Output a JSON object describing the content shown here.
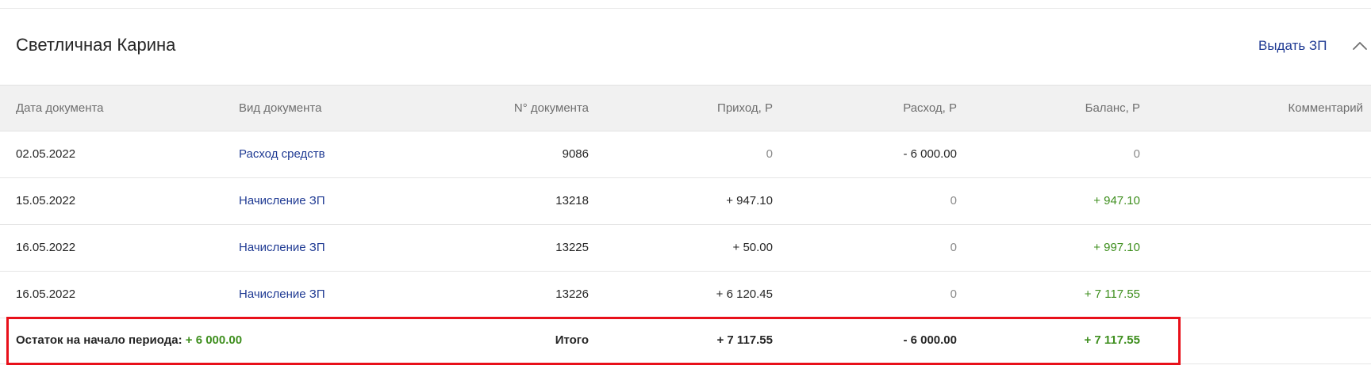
{
  "header": {
    "name": "Светличная Карина",
    "pay_button": "Выдать ЗП",
    "collapse_icon": "chevron-up-icon"
  },
  "table": {
    "columns": {
      "date": "Дата документа",
      "type": "Вид документа",
      "number": "N° документа",
      "income": "Приход, Р",
      "expense": "Расход, Р",
      "balance": "Баланс, Р",
      "comment": "Комментарий"
    },
    "rows": [
      {
        "date": "02.05.2022",
        "type": "Расход средств",
        "number": "9086",
        "income": "0",
        "expense": "- 6 000.00",
        "balance": "0"
      },
      {
        "date": "15.05.2022",
        "type": "Начисление ЗП",
        "number": "13218",
        "income": "+ 947.10",
        "expense": "0",
        "balance": "+ 947.10"
      },
      {
        "date": "16.05.2022",
        "type": "Начисление ЗП",
        "number": "13225",
        "income": "+ 50.00",
        "expense": "0",
        "balance": "+ 997.10"
      },
      {
        "date": "16.05.2022",
        "type": "Начисление ЗП",
        "number": "13226",
        "income": "+ 6 120.45",
        "expense": "0",
        "balance": "+ 7 117.55"
      }
    ],
    "summary": {
      "opening_label": "Остаток на начало периода:",
      "opening_value": "+ 6 000.00",
      "total_label": "Итого",
      "income": "+ 7 117.55",
      "expense": "- 6 000.00",
      "balance": "+ 7 117.55"
    }
  },
  "colors": {
    "link": "#1f3a93",
    "positive": "#3f8f1f",
    "highlight": "#e8101a",
    "header_bg": "#f1f1f1"
  }
}
